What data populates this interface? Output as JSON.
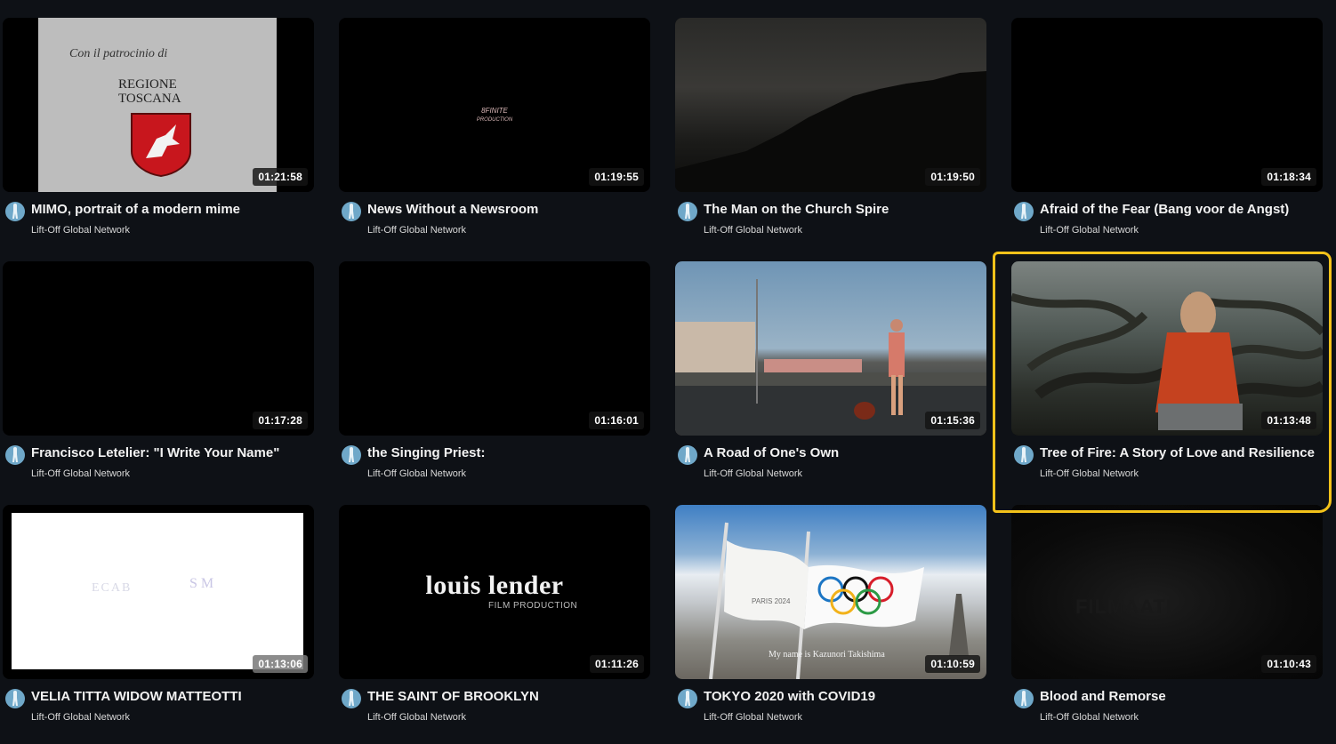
{
  "videos": [
    {
      "title": "MIMO, portrait of a modern mime",
      "channel": "Lift-Off Global Network",
      "duration": "01:21:58",
      "thumb_text": {
        "line1": "Con il patrocinio di",
        "line2": "REGIONE",
        "line3": "TOSCANA"
      }
    },
    {
      "title": "News Without a Newsroom",
      "channel": "Lift-Off Global Network",
      "duration": "01:19:55",
      "thumb_text": {
        "logo": "8FINITE",
        "logo_sub": "PRODUCTION"
      }
    },
    {
      "title": "The Man on the Church Spire",
      "channel": "Lift-Off Global Network",
      "duration": "01:19:50"
    },
    {
      "title": "Afraid of the Fear (Bang voor de Angst)",
      "channel": "Lift-Off Global Network",
      "duration": "01:18:34"
    },
    {
      "title": "Francisco Letelier: \"I Write Your Name\"",
      "channel": "Lift-Off Global Network",
      "duration": "01:17:28"
    },
    {
      "title": "the Singing Priest:",
      "channel": "Lift-Off Global Network",
      "duration": "01:16:01"
    },
    {
      "title": "A Road of One's Own",
      "channel": "Lift-Off Global Network",
      "duration": "01:15:36"
    },
    {
      "title": "Tree of Fire: A Story of Love and Resilience",
      "channel": "Lift-Off Global Network",
      "duration": "01:13:48"
    },
    {
      "title": "VELIA TITTA WIDOW MATTEOTTI",
      "channel": "Lift-Off Global Network",
      "duration": "01:13:06",
      "thumb_text": {
        "left": "ECAB",
        "right": "S M"
      }
    },
    {
      "title": "THE SAINT OF BROOKLYN",
      "channel": "Lift-Off Global Network",
      "duration": "01:11:26",
      "thumb_text": {
        "brand": "louis lender",
        "sub": "FILM PRODUCTION"
      }
    },
    {
      "title": "TOKYO 2020 with COVID19",
      "channel": "Lift-Off Global Network",
      "duration": "01:10:59",
      "thumb_text": {
        "flag": "PARIS 2024",
        "caption": "My name is Kazunori Takishima"
      }
    },
    {
      "title": "Blood and Remorse",
      "channel": "Lift-Off Global Network",
      "duration": "01:10:43",
      "thumb_text": {
        "ghost": "FILMAATI"
      }
    }
  ],
  "highlighted_index": 7,
  "colors": {
    "background": "#0e1116",
    "highlight": "#f3c21a",
    "avatar": "#6fa8c9"
  }
}
